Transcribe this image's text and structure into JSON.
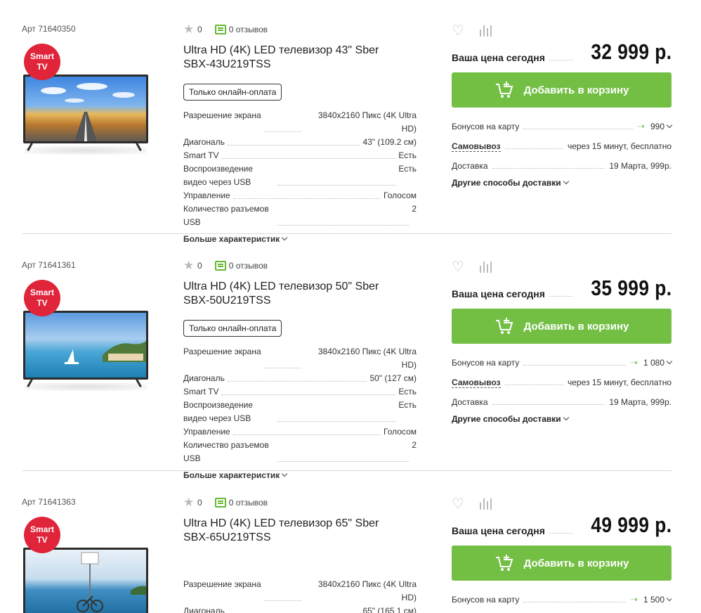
{
  "products": [
    {
      "art": "Арт 71640350",
      "badge": "Smart TV",
      "rating": "0",
      "reviews": "0 отзывов",
      "title": "Ultra HD (4K) LED телевизор 43\" Sber SBX-43U219TSS",
      "online_only": "Только онлайн-оплата",
      "specs": [
        {
          "k": "Разрешение экрана",
          "v": "3840x2160 Пикс (4K Ultra HD)"
        },
        {
          "k": "Диагональ",
          "v": "43\" (109.2 см)"
        },
        {
          "k": "Smart TV",
          "v": "Есть"
        },
        {
          "k": "Воспроизведение видео через USB",
          "v": "Есть"
        },
        {
          "k": "Управление",
          "v": "Голосом"
        },
        {
          "k": "Количество разъемов USB",
          "v": "2"
        }
      ],
      "more": "Больше характеристик",
      "price_label": "Ваша цена сегодня",
      "price": "32 999 р.",
      "cart": "Добавить в корзину",
      "bonus_label": "Бонусов на карту",
      "bonus_value": "990",
      "pickup_label": "Самовывоз",
      "pickup_value": "через 15 минут, бесплатно",
      "delivery_label": "Доставка",
      "delivery_value": "19 Марта, 999р.",
      "other_delivery": "Другие способы доставки",
      "image": "road"
    },
    {
      "art": "Арт 71641361",
      "badge": "Smart TV",
      "rating": "0",
      "reviews": "0 отзывов",
      "title": "Ultra HD (4K) LED телевизор 50\" Sber SBX-50U219TSS",
      "online_only": "Только онлайн-оплата",
      "specs": [
        {
          "k": "Разрешение экрана",
          "v": "3840x2160 Пикс (4K Ultra HD)"
        },
        {
          "k": "Диагональ",
          "v": "50\" (127 см)"
        },
        {
          "k": "Smart TV",
          "v": "Есть"
        },
        {
          "k": "Воспроизведение видео через USB",
          "v": "Есть"
        },
        {
          "k": "Управление",
          "v": "Голосом"
        },
        {
          "k": "Количество разъемов USB",
          "v": "2"
        }
      ],
      "more": "Больше характеристик",
      "price_label": "Ваша цена сегодня",
      "price": "35 999 р.",
      "cart": "Добавить в корзину",
      "bonus_label": "Бонусов на карту",
      "bonus_value": "1 080",
      "pickup_label": "Самовывоз",
      "pickup_value": "через 15 минут, бесплатно",
      "delivery_label": "Доставка",
      "delivery_value": "19 Марта, 999р.",
      "other_delivery": "Другие способы доставки",
      "image": "coast"
    },
    {
      "art": "Арт 71641363",
      "badge": "Smart TV",
      "rating": "0",
      "reviews": "0 отзывов",
      "title": "Ultra HD (4K) LED телевизор 65\" Sber SBX-65U219TSS",
      "online_only": "",
      "specs": [
        {
          "k": "Разрешение экрана",
          "v": "3840x2160 Пикс (4K Ultra HD)"
        },
        {
          "k": "Диагональ",
          "v": "65\" (165.1 см)"
        }
      ],
      "more": "",
      "price_label": "Ваша цена сегодня",
      "price": "49 999 р.",
      "cart": "Добавить в корзину",
      "bonus_label": "Бонусов на карту",
      "bonus_value": "1 500",
      "pickup_label": "",
      "pickup_value": "",
      "delivery_label": "",
      "delivery_value": "",
      "other_delivery": "",
      "image": "bike"
    }
  ],
  "colors": {
    "accent_green": "#72bf44",
    "badge_red": "#e0243a"
  }
}
